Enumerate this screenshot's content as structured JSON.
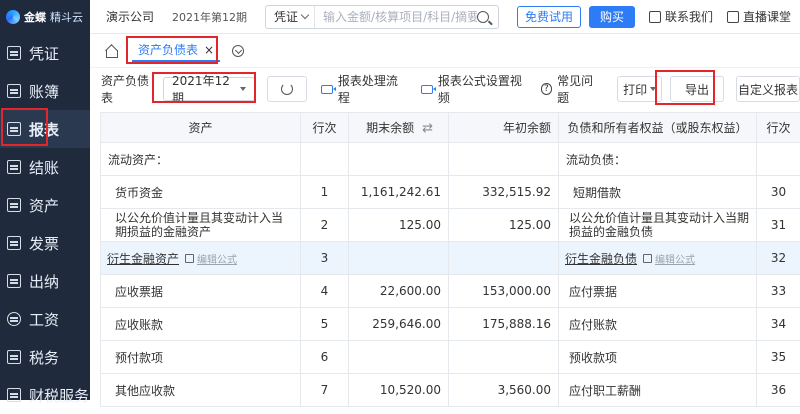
{
  "brand": {
    "name": "金蝶",
    "sub": "精斗云"
  },
  "sidebar": {
    "items": [
      {
        "label": "凭证",
        "icon": "voucher-icon"
      },
      {
        "label": "账簿",
        "icon": "ledger-icon"
      },
      {
        "label": "报表",
        "icon": "report-icon",
        "active": true
      },
      {
        "label": "结账",
        "icon": "closing-icon"
      },
      {
        "label": "资产",
        "icon": "asset-icon"
      },
      {
        "label": "发票",
        "icon": "invoice-icon"
      },
      {
        "label": "出纳",
        "icon": "cashier-icon"
      },
      {
        "label": "工资",
        "icon": "salary-icon"
      },
      {
        "label": "税务",
        "icon": "tax-icon"
      },
      {
        "label": "财税服务",
        "icon": "service-icon"
      }
    ]
  },
  "topbar": {
    "company": "演示公司",
    "period": "2021年第12期",
    "search_type": "凭证",
    "search_placeholder": "输入金额/核算项目/科目/摘要",
    "trial_label": "免费试用",
    "buy_label": "购买",
    "contact_label": "联系我们",
    "live_label": "直播课堂"
  },
  "tabs": {
    "active_label": "资产负债表",
    "close": "×"
  },
  "toolbar": {
    "label": "资产负债表",
    "period_value": "2021年12期",
    "process_label": "报表处理流程",
    "formula_video_label": "报表公式设置视频",
    "faq_label": "常见问题",
    "print_label": "打印",
    "export_label": "导出",
    "custom_label": "自定义报表"
  },
  "table": {
    "headers": {
      "asset": "资产",
      "row_no": "行次",
      "end_balance": "期末余额",
      "begin_balance": "年初余额",
      "liability": "负债和所有者权益（或股东权益）",
      "row_no2": "行次"
    },
    "edit_formula": "编辑公式",
    "rows": [
      {
        "asset": "流动资产：",
        "no": "",
        "end": "",
        "begin": "",
        "liab": "流动负债：",
        "no2": ""
      },
      {
        "asset": "货币资金",
        "no": "1",
        "end": "1,161,242.61",
        "begin": "332,515.92",
        "liab": "短期借款",
        "no2": "30"
      },
      {
        "asset": "以公允价值计量且其变动计入当期损益的金融资产",
        "no": "2",
        "end": "125.00",
        "begin": "125.00",
        "liab": "以公允价值计量且其变动计入当期损益的金融负债",
        "no2": "31"
      },
      {
        "asset": "衍生金融资产",
        "no": "3",
        "end": "",
        "begin": "",
        "liab": "衍生金融负债",
        "no2": "32"
      },
      {
        "asset": "应收票据",
        "no": "4",
        "end": "22,600.00",
        "begin": "153,000.00",
        "liab": "应付票据",
        "no2": "33"
      },
      {
        "asset": "应收账款",
        "no": "5",
        "end": "259,646.00",
        "begin": "175,888.16",
        "liab": "应付账款",
        "no2": "34"
      },
      {
        "asset": "预付款项",
        "no": "6",
        "end": "",
        "begin": "",
        "liab": "预收款项",
        "no2": "35"
      },
      {
        "asset": "其他应收款",
        "no": "7",
        "end": "10,520.00",
        "begin": "3,560.00",
        "liab": "应付职工薪酬",
        "no2": "36"
      }
    ]
  },
  "colors": {
    "sidebar": "#1f2a3d",
    "accent": "#2d7cf6",
    "highlight": "#e3262b"
  }
}
